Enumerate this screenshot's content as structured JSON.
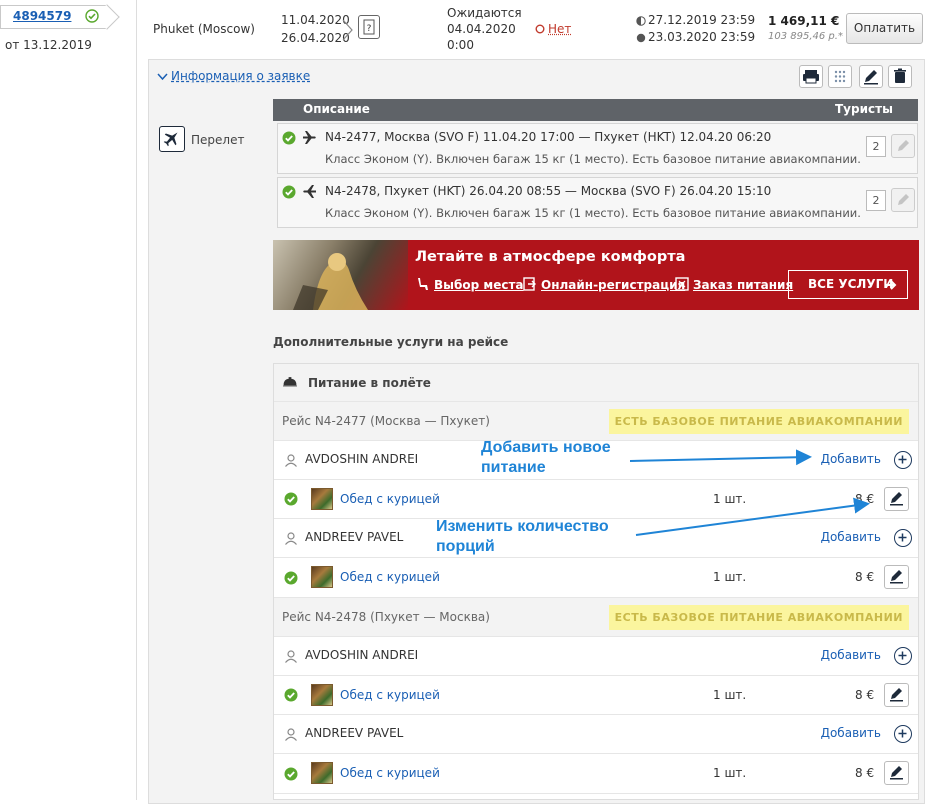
{
  "order": {
    "number": "4894579",
    "date": "от 13.12.2019"
  },
  "header": {
    "hotel": "Phuket (Moscow)",
    "date_from": "11.04.2020",
    "date_to": "26.04.2020",
    "status_line1": "Ожидаются",
    "status_line2": "04.04.2020",
    "status_line3": "0:00",
    "payment_status": "Нет",
    "deadline1": "27.12.2019 23:59",
    "deadline2": "23.03.2020 23:59",
    "price_eur": "1 469,11 €",
    "price_rub": "103 895,46 р.*",
    "pay_button": "Оплатить"
  },
  "panel": {
    "info_link": "Информация о заявке",
    "section_label": "Перелет",
    "col_description": "Описание",
    "col_tourists": "Туристы"
  },
  "flights": [
    {
      "line1": "N4-2477, Москва (SVO F) 11.04.20 17:00 — Пхукет (HKT) 12.04.20 06:20",
      "line2": "Класс Эконом (Y). Включен багаж 15 кг (1 место). Есть базовое питание авиакомпании.",
      "tourists": "2"
    },
    {
      "line1": "N4-2478, Пхукет (HKT) 26.04.20 08:55 — Москва (SVO F) 26.04.20 15:10",
      "line2": "Класс Эконом (Y). Включен багаж 15 кг (1 место). Есть базовое питание авиакомпании.",
      "tourists": "2"
    }
  ],
  "banner": {
    "title": "Летайте в атмосфере комфорта",
    "link1": "Выбор места",
    "link2": "Онлайн-регистрация",
    "link3": "Заказ питания",
    "button": "ВСЕ УСЛУГИ"
  },
  "extras": {
    "title": "Дополнительные услуги на рейсе",
    "meal_header": "Питание в полёте",
    "chip": "ЕСТЬ БАЗОВОЕ ПИТАНИЕ АВИАКОМПАНИИ",
    "add_label": "Добавить",
    "segments": [
      {
        "title": "Рейс N4-2477 (Москва — Пхукет)",
        "passengers": [
          {
            "name": "AVDOSHIN ANDREI",
            "meal": "Обед с курицей",
            "qty": "1 шт.",
            "price": "8 €"
          },
          {
            "name": "ANDREEV PAVEL",
            "meal": "Обед с курицей",
            "qty": "1 шт.",
            "price": "8 €"
          }
        ]
      },
      {
        "title": "Рейс N4-2478 (Пхукет — Москва)",
        "passengers": [
          {
            "name": "AVDOSHIN ANDREI",
            "meal": "Обед с курицей",
            "qty": "1 шт.",
            "price": "8 €"
          },
          {
            "name": "ANDREEV PAVEL",
            "meal": "Обед с курицей",
            "qty": "1 шт.",
            "price": "8 €"
          }
        ]
      }
    ]
  },
  "annotations": {
    "add_meal_l1": "Добавить новое",
    "add_meal_l2": "питание",
    "change_qty_l1": "Изменить количество",
    "change_qty_l2": "порций"
  },
  "colors": {
    "accent": "#1a5fb4",
    "ok_green": "#5aa82e",
    "banner_red": "#b1141b",
    "chip_yellow": "#fbf59e",
    "annotation_blue": "#1f84d6"
  }
}
